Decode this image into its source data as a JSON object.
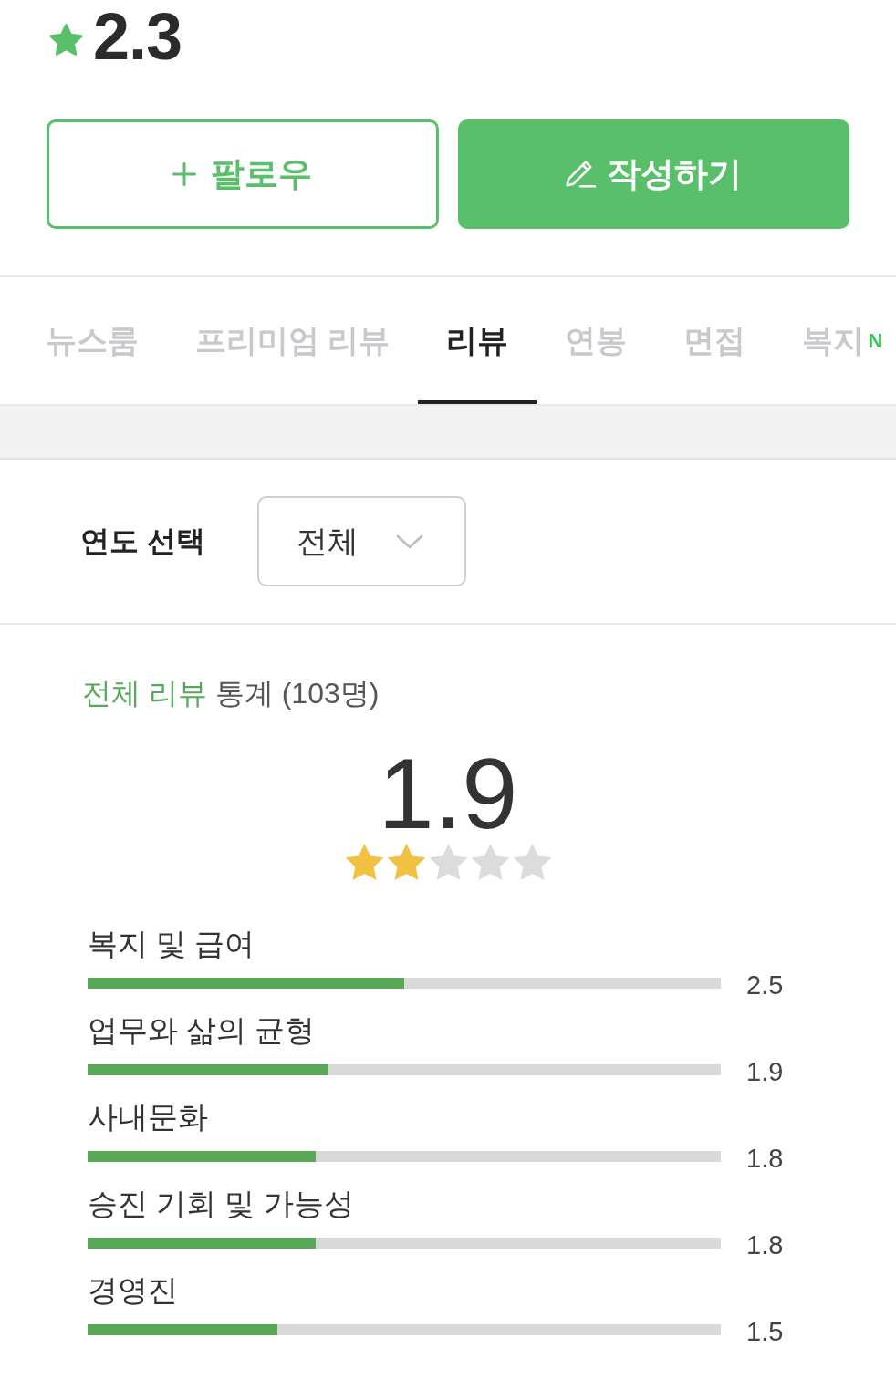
{
  "company_rating": {
    "value": "2.3"
  },
  "actions": [
    {
      "kind": "follow",
      "label": "팔로우"
    },
    {
      "kind": "write",
      "label": "작성하기"
    }
  ],
  "tabs": [
    {
      "label": "뉴스룸",
      "selected": false
    },
    {
      "label": "프리미엄 리뷰",
      "selected": false
    },
    {
      "label": "리뷰",
      "selected": true
    },
    {
      "label": "연봉",
      "selected": false
    },
    {
      "label": "면접",
      "selected": false
    },
    {
      "label": "복지",
      "selected": false,
      "badge": "N"
    }
  ],
  "year_filter": {
    "label": "연도 선택",
    "value": "전체"
  },
  "stats": {
    "title_highlight": "전체 리뷰",
    "title_rest": "통계 (103명)",
    "overall": "1.9",
    "stars": 2,
    "categories": [
      {
        "name": "복지 및 급여",
        "level": 0.5,
        "score": "2.5"
      },
      {
        "name": "업무와 삶의 균형",
        "level": 0.38,
        "score": "1.9"
      },
      {
        "name": "사내문화",
        "level": 0.36,
        "score": "1.8"
      },
      {
        "name": "승진 기회 및 가능성",
        "level": 0.36,
        "score": "1.8"
      },
      {
        "name": "경영진",
        "level": 0.3,
        "score": "1.5"
      }
    ]
  }
}
